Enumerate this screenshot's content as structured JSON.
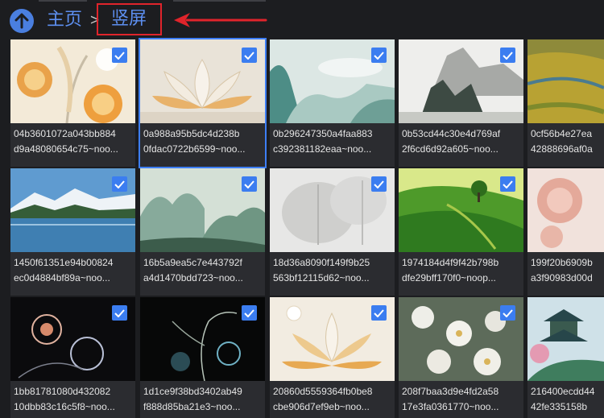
{
  "breadcrumb": {
    "home_label": "主页",
    "separator": ">",
    "current_label": "竖屏"
  },
  "colors": {
    "accent": "#3b7df0",
    "annotation": "#e0242b",
    "background": "#1c1d20"
  },
  "files": [
    {
      "line1": "04b3601072a043bb884",
      "line2": "d9a48080654c75~noo...",
      "checked": true
    },
    {
      "line1": "0a988a95b5dc4d238b",
      "line2": "0fdac0722b6599~noo...",
      "checked": true,
      "selected": true
    },
    {
      "line1": "0b296247350a4faa883",
      "line2": "c392381182eaa~noo...",
      "checked": true
    },
    {
      "line1": "0b53cd44c30e4d769af",
      "line2": "2f6cd6d92a605~noo...",
      "checked": true
    },
    {
      "line1": "0cf56b4e27ea",
      "line2": "42888696af0a",
      "checked": false
    },
    {
      "line1": "1450f61351e94b00824",
      "line2": "ec0d4884bf89a~noo...",
      "checked": true
    },
    {
      "line1": "16b5a9ea5c7e443792f",
      "line2": "a4d1470bdd723~noo...",
      "checked": true
    },
    {
      "line1": "18d36a8090f149f9b25",
      "line2": "563bf12115d62~noo...",
      "checked": true
    },
    {
      "line1": "1974184d4f9f42b798b",
      "line2": "dfe29bff170f0~noop...",
      "checked": true
    },
    {
      "line1": "199f20b6909b",
      "line2": "a3f90983d00d",
      "checked": false
    },
    {
      "line1": "1bb81781080d432082",
      "line2": "10dbb83c16c5f8~noo...",
      "checked": true
    },
    {
      "line1": "1d1ce9f38bd3402ab49",
      "line2": "f888d85ba21e3~noo...",
      "checked": true
    },
    {
      "line1": "20860d5559364fb0be8",
      "line2": "cbe906d7ef9eb~noo...",
      "checked": true
    },
    {
      "line1": "208f7baa3d9e4fd2a58",
      "line2": "17e3fa0361770~noo...",
      "checked": true
    },
    {
      "line1": "216400ecdd44",
      "line2": "42fe335158b",
      "checked": false
    }
  ]
}
